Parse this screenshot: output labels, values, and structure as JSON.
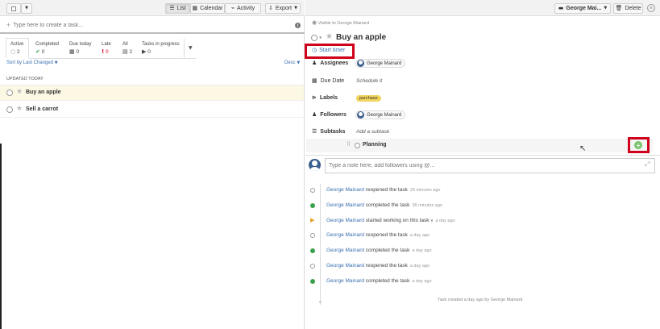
{
  "toolbar": {
    "list": "List",
    "calendar": "Calendar",
    "activity": "Activity",
    "export": "Export",
    "user_menu": "George Mai...",
    "delete": "Delete"
  },
  "new_task": {
    "placeholder": "Type here to create a task..."
  },
  "tabs": [
    {
      "label": "Active",
      "count": "2"
    },
    {
      "label": "Completed",
      "count": "0"
    },
    {
      "label": "Due today",
      "count": "0"
    },
    {
      "label": "Late",
      "count": "0"
    },
    {
      "label": "All",
      "count": "2"
    },
    {
      "label": "Tasks in progress",
      "count": "0"
    }
  ],
  "sort": {
    "label": "Sort by Last Changed",
    "order": "Desc"
  },
  "group_header": "UPDATED TODAY",
  "tasks": [
    {
      "title": "Buy an apple"
    },
    {
      "title": "Sell a carrot"
    }
  ],
  "detail": {
    "visibility": "Visible to George Mainard",
    "title": "Buy an apple",
    "start_timer": "Start timer",
    "assignees_label": "Assignees",
    "assignee": "George Mainard",
    "due_label": "Due Date",
    "due_value": "Schedule it",
    "labels_label": "Labels",
    "label_tag": "purchase",
    "followers_label": "Followers",
    "follower": "George Mainard",
    "subtasks_label": "Subtasks",
    "add_subtask": "Add a subtask",
    "subtask": "Planning",
    "note_placeholder": "Type a note here, add followers using @..."
  },
  "timeline": [
    {
      "who": "George Mainard",
      "action": "reopened the task",
      "ago": "29 minutes ago",
      "status": "open"
    },
    {
      "who": "George Mainard",
      "action": "completed the task",
      "ago": "38 minutes ago",
      "status": "done"
    },
    {
      "who": "George Mainard",
      "action": "started working on this task",
      "ago": "a day ago",
      "status": "progress"
    },
    {
      "who": "George Mainard",
      "action": "reopened the task",
      "ago": "a day ago",
      "status": "open"
    },
    {
      "who": "George Mainard",
      "action": "completed the task",
      "ago": "a day ago",
      "status": "done"
    },
    {
      "who": "George Mainard",
      "action": "reopened the task",
      "ago": "a day ago",
      "status": "open"
    },
    {
      "who": "George Mainard",
      "action": "completed the task",
      "ago": "a day ago",
      "status": "done"
    }
  ],
  "created_note": "Task created a day ago by George Mainard",
  "colors": {
    "accent": "#3a6fb0",
    "highlight": "#d0021b",
    "done": "#3aa04a",
    "progress": "#e6a01e",
    "selected_row": "#fdf8e4"
  }
}
